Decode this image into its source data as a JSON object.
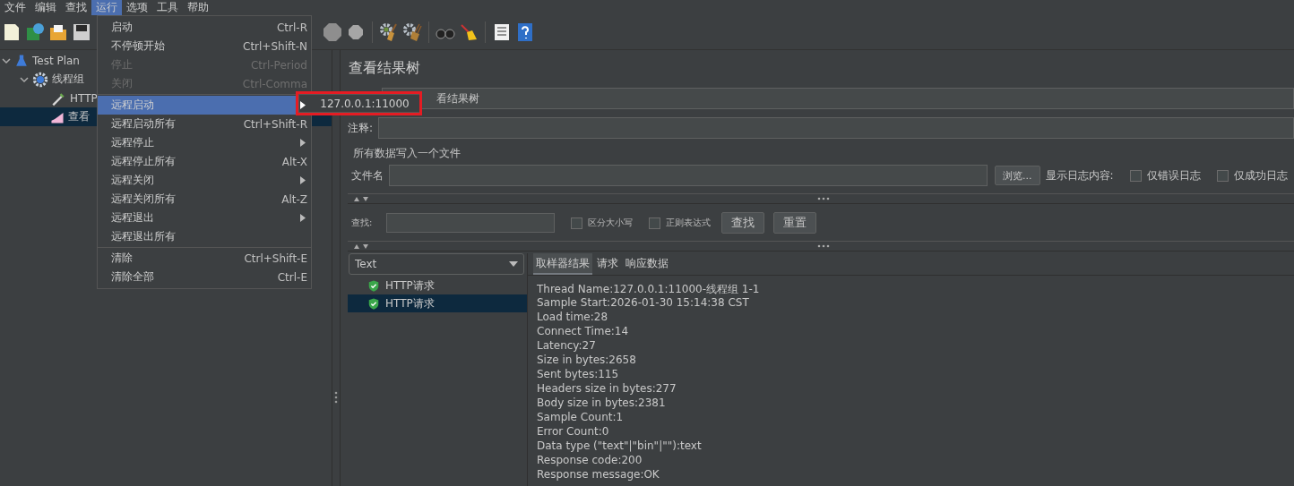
{
  "menubar": [
    {
      "label": "文件",
      "selected": false
    },
    {
      "label": "编辑",
      "selected": false
    },
    {
      "label": "查找",
      "selected": false
    },
    {
      "label": "运行",
      "selected": true
    },
    {
      "label": "选项",
      "selected": false
    },
    {
      "label": "工具",
      "selected": false
    },
    {
      "label": "帮助",
      "selected": false
    }
  ],
  "tree": [
    {
      "label": "Test Plan",
      "selected": false,
      "expanded": true,
      "kind": "plan",
      "children": [
        {
          "label": "线程组",
          "selected": false,
          "expanded": true,
          "kind": "group",
          "children": [
            {
              "label": "HTTP",
              "selected": false,
              "kind": "sampler"
            },
            {
              "label": "查看",
              "selected": true,
              "kind": "listener"
            }
          ]
        }
      ]
    }
  ],
  "run_menu": [
    {
      "kind": "item",
      "label": "启动",
      "shortcut": "Ctrl-R",
      "disabled": false,
      "selected": false,
      "submenu": false
    },
    {
      "kind": "item",
      "label": "不停顿开始",
      "shortcut": "Ctrl+Shift-N",
      "disabled": false,
      "selected": false,
      "submenu": false
    },
    {
      "kind": "item",
      "label": "停止",
      "shortcut": "Ctrl-Period",
      "disabled": true,
      "selected": false,
      "submenu": false
    },
    {
      "kind": "item",
      "label": "关闭",
      "shortcut": "Ctrl-Comma",
      "disabled": true,
      "selected": false,
      "submenu": false
    },
    {
      "kind": "separator"
    },
    {
      "kind": "item",
      "label": "远程启动",
      "disabled": false,
      "selected": true,
      "submenu": true
    },
    {
      "kind": "item",
      "label": "远程启动所有",
      "shortcut": "Ctrl+Shift-R",
      "disabled": false,
      "selected": false,
      "submenu": false
    },
    {
      "kind": "item",
      "label": "远程停止",
      "disabled": false,
      "selected": false,
      "submenu": true
    },
    {
      "kind": "item",
      "label": "远程停止所有",
      "shortcut": "Alt-X",
      "disabled": false,
      "selected": false,
      "submenu": false
    },
    {
      "kind": "item",
      "label": "远程关闭",
      "disabled": false,
      "selected": false,
      "submenu": true
    },
    {
      "kind": "item",
      "label": "远程关闭所有",
      "shortcut": "Alt-Z",
      "disabled": false,
      "selected": false,
      "submenu": false
    },
    {
      "kind": "item",
      "label": "远程退出",
      "disabled": false,
      "selected": false,
      "submenu": true
    },
    {
      "kind": "item",
      "label": "远程退出所有",
      "disabled": false,
      "selected": false,
      "submenu": false
    },
    {
      "kind": "separator"
    },
    {
      "kind": "item",
      "label": "清除",
      "shortcut": "Ctrl+Shift-E",
      "disabled": false,
      "selected": false,
      "submenu": false
    },
    {
      "kind": "item",
      "label": "清除全部",
      "shortcut": "Ctrl-E",
      "disabled": false,
      "selected": false,
      "submenu": false
    }
  ],
  "submenu": {
    "items": [
      "127.0.0.1:11000"
    ]
  },
  "panel": {
    "title": "查看结果树",
    "name_value": "看结果树",
    "comment_label": "注释:",
    "file_group": {
      "legend": "所有数据写入一个文件",
      "file_label": "文件名",
      "browse": "浏览...",
      "log_label": "显示日志内容:",
      "checkboxes": [
        {
          "label": "仅错误日志",
          "checked": false
        },
        {
          "label": "仅成功日志",
          "checked": false
        }
      ]
    },
    "search": {
      "label": "查找:",
      "checkboxes": [
        {
          "label": "区分大小写",
          "checked": false
        },
        {
          "label": "正则表达式",
          "checked": false
        }
      ],
      "buttons": [
        "查找",
        "重置"
      ]
    },
    "renderer": "Text",
    "results": [
      {
        "label": "HTTP请求",
        "selected": false
      },
      {
        "label": "HTTP请求",
        "selected": true
      }
    ],
    "tabs": [
      {
        "label": "取样器结果",
        "selected": true
      },
      {
        "label": "请求",
        "selected": false
      },
      {
        "label": "响应数据",
        "selected": false
      }
    ],
    "details": [
      "Thread Name:127.0.0.1:11000-线程组 1-1",
      "Sample Start:2026-01-30 15:14:38 CST",
      "Load time:28",
      "Connect Time:14",
      "Latency:27",
      "Size in bytes:2658",
      "Sent bytes:115",
      "Headers size in bytes:277",
      "Body size in bytes:2381",
      "Sample Count:1",
      "Error Count:0",
      "Data type (\"text\"|\"bin\"|\"\"):text",
      "Response code:200",
      "Response message:OK"
    ]
  }
}
